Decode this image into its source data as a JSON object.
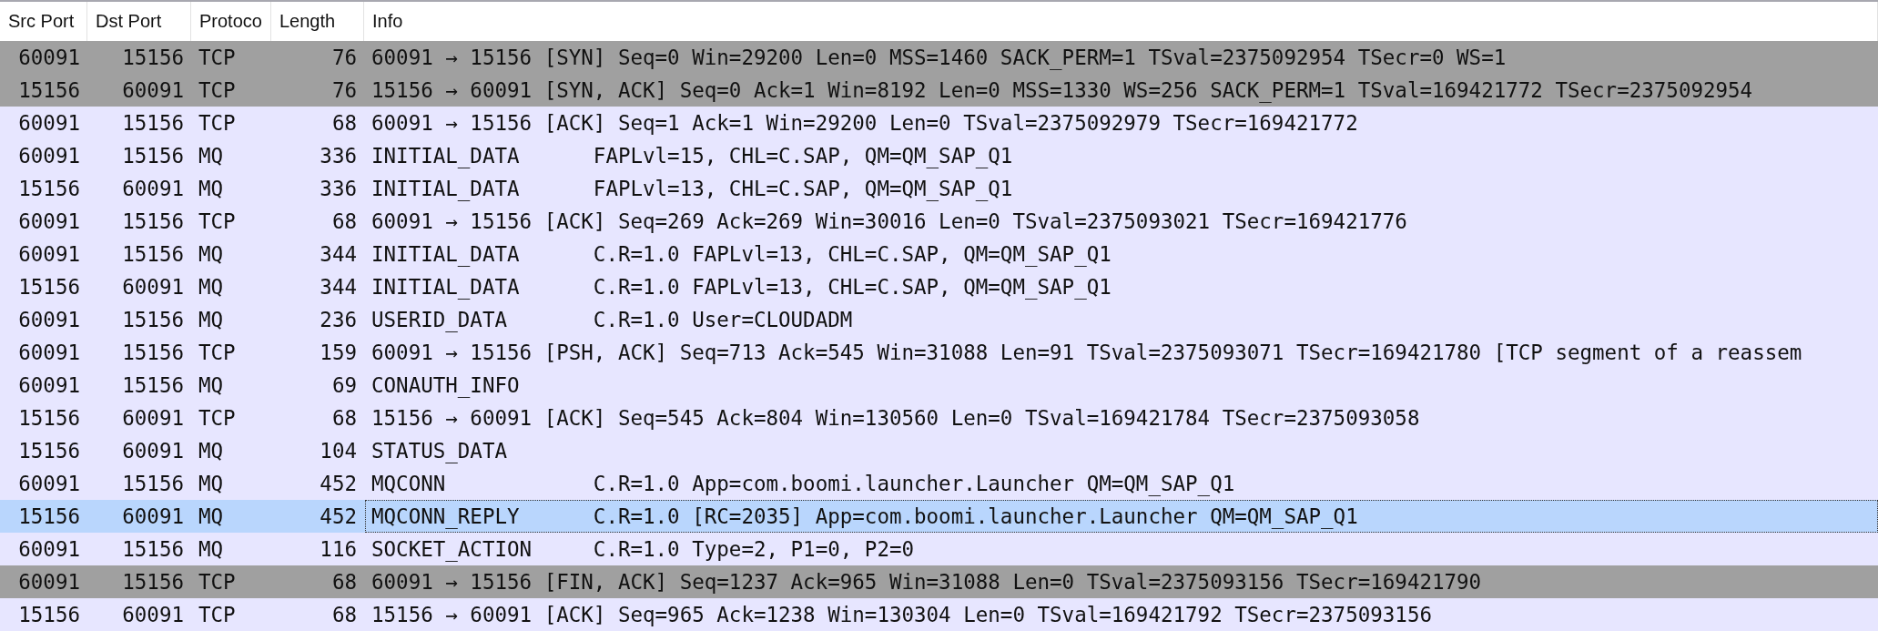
{
  "table": {
    "columns": [
      "Src Port",
      "Dst Port",
      "Protoco",
      "Length",
      "Info"
    ],
    "rows": [
      {
        "src_port": "60091",
        "dst_port": "15156",
        "protocol": "TCP",
        "length": "76",
        "info": "60091 → 15156 [SYN] Seq=0 Win=29200 Len=0 MSS=1460 SACK_PERM=1 TSval=2375092954 TSecr=0 WS=1",
        "color": "#a0a0a0",
        "selected": false
      },
      {
        "src_port": "15156",
        "dst_port": "60091",
        "protocol": "TCP",
        "length": "76",
        "info": "15156 → 60091 [SYN, ACK] Seq=0 Ack=1 Win=8192 Len=0 MSS=1330 WS=256 SACK_PERM=1 TSval=169421772 TSecr=2375092954",
        "color": "#a0a0a0",
        "selected": false
      },
      {
        "src_port": "60091",
        "dst_port": "15156",
        "protocol": "TCP",
        "length": "68",
        "info": "60091 → 15156 [ACK] Seq=1 Ack=1 Win=29200 Len=0 TSval=2375092979 TSecr=169421772",
        "color": "#e7e6ff",
        "selected": false
      },
      {
        "src_port": "60091",
        "dst_port": "15156",
        "protocol": "MQ",
        "length": "336",
        "info": "INITIAL_DATA      FAPLvl=15, CHL=C.SAP, QM=QM_SAP_Q1",
        "color": "#e7e6ff",
        "selected": false
      },
      {
        "src_port": "15156",
        "dst_port": "60091",
        "protocol": "MQ",
        "length": "336",
        "info": "INITIAL_DATA      FAPLvl=13, CHL=C.SAP, QM=QM_SAP_Q1",
        "color": "#e7e6ff",
        "selected": false
      },
      {
        "src_port": "60091",
        "dst_port": "15156",
        "protocol": "TCP",
        "length": "68",
        "info": "60091 → 15156 [ACK] Seq=269 Ack=269 Win=30016 Len=0 TSval=2375093021 TSecr=169421776",
        "color": "#e7e6ff",
        "selected": false
      },
      {
        "src_port": "60091",
        "dst_port": "15156",
        "protocol": "MQ",
        "length": "344",
        "info": "INITIAL_DATA      C.R=1.0 FAPLvl=13, CHL=C.SAP, QM=QM_SAP_Q1",
        "color": "#e7e6ff",
        "selected": false
      },
      {
        "src_port": "15156",
        "dst_port": "60091",
        "protocol": "MQ",
        "length": "344",
        "info": "INITIAL_DATA      C.R=1.0 FAPLvl=13, CHL=C.SAP, QM=QM_SAP_Q1",
        "color": "#e7e6ff",
        "selected": false
      },
      {
        "src_port": "60091",
        "dst_port": "15156",
        "protocol": "MQ",
        "length": "236",
        "info": "USERID_DATA       C.R=1.0 User=CLOUDADM",
        "color": "#e7e6ff",
        "selected": false
      },
      {
        "src_port": "60091",
        "dst_port": "15156",
        "protocol": "TCP",
        "length": "159",
        "info": "60091 → 15156 [PSH, ACK] Seq=713 Ack=545 Win=31088 Len=91 TSval=2375093071 TSecr=169421780 [TCP segment of a reassem",
        "color": "#e7e6ff",
        "selected": false
      },
      {
        "src_port": "60091",
        "dst_port": "15156",
        "protocol": "MQ",
        "length": "69",
        "info": "CONAUTH_INFO",
        "color": "#e7e6ff",
        "selected": false
      },
      {
        "src_port": "15156",
        "dst_port": "60091",
        "protocol": "TCP",
        "length": "68",
        "info": "15156 → 60091 [ACK] Seq=545 Ack=804 Win=130560 Len=0 TSval=169421784 TSecr=2375093058",
        "color": "#e7e6ff",
        "selected": false
      },
      {
        "src_port": "15156",
        "dst_port": "60091",
        "protocol": "MQ",
        "length": "104",
        "info": "STATUS_DATA",
        "color": "#e7e6ff",
        "selected": false
      },
      {
        "src_port": "60091",
        "dst_port": "15156",
        "protocol": "MQ",
        "length": "452",
        "info": "MQCONN            C.R=1.0 App=com.boomi.launcher.Launcher QM=QM_SAP_Q1",
        "color": "#e7e6ff",
        "selected": false
      },
      {
        "src_port": "15156",
        "dst_port": "60091",
        "protocol": "MQ",
        "length": "452",
        "info": "MQCONN_REPLY      C.R=1.0 [RC=2035] App=com.boomi.launcher.Launcher QM=QM_SAP_Q1",
        "color": "#b9d6fd",
        "selected": true
      },
      {
        "src_port": "60091",
        "dst_port": "15156",
        "protocol": "MQ",
        "length": "116",
        "info": "SOCKET_ACTION     C.R=1.0 Type=2, P1=0, P2=0",
        "color": "#e7e6ff",
        "selected": false
      },
      {
        "src_port": "60091",
        "dst_port": "15156",
        "protocol": "TCP",
        "length": "68",
        "info": "60091 → 15156 [FIN, ACK] Seq=1237 Ack=965 Win=31088 Len=0 TSval=2375093156 TSecr=169421790",
        "color": "#a0a0a0",
        "selected": false
      },
      {
        "src_port": "15156",
        "dst_port": "60091",
        "protocol": "TCP",
        "length": "68",
        "info": "15156 → 60091 [ACK] Seq=965 Ack=1238 Win=130304 Len=0 TSval=169421792 TSecr=2375093156",
        "color": "#e7e6ff",
        "selected": false
      }
    ]
  }
}
